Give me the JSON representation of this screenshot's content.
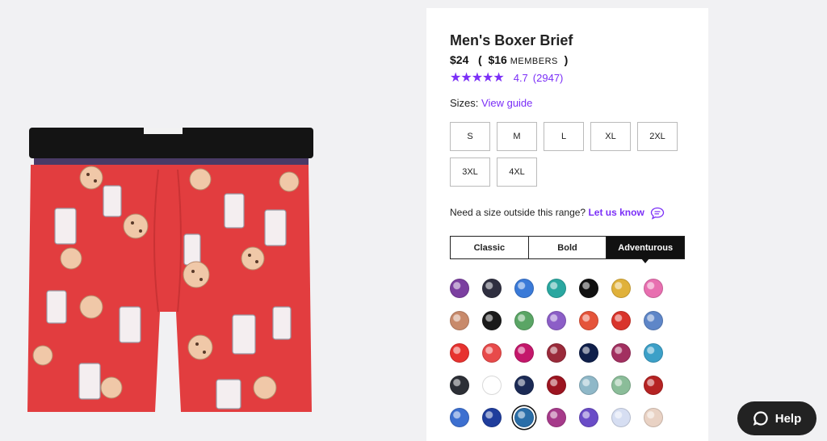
{
  "product": {
    "title": "Men's Boxer Brief",
    "price": "$24",
    "paren_open": "(",
    "member_price": "$16",
    "members_label": "MEMBERS",
    "paren_close": ")",
    "stars": "★★★★★",
    "rating": "4.7",
    "review_count": "(2947)"
  },
  "sizes": {
    "label": "Sizes:",
    "guide_link": "View guide",
    "options": [
      "S",
      "M",
      "L",
      "XL",
      "2XL",
      "3XL",
      "4XL"
    ]
  },
  "size_help": {
    "text": "Need a size outside this range?",
    "link": "Let us know",
    "icon": "chat-bubble-icon"
  },
  "style_tabs": {
    "tabs": [
      "Classic",
      "Bold",
      "Adventurous"
    ],
    "active": "Adventurous"
  },
  "swatch_colors": [
    [
      "#7b3fa0",
      "#2f2f40",
      "#3a7ad8",
      "#2aa7a0",
      "#111111",
      "#e0b13a",
      "#e86fb0"
    ],
    [
      "#c88a6b",
      "#1a1a1a",
      "#5aa565",
      "#8c5ec7",
      "#e5543a",
      "#d9342b",
      "#5e86c8"
    ],
    [
      "#e7322f",
      "#e84a4a",
      "#c4176b",
      "#9a2a3a",
      "#0f1f4a",
      "#a23060",
      "#3ca0c8"
    ],
    [
      "#2c2f36",
      "#ffffff",
      "#1b2a55",
      "#9c1420",
      "#8fb8c8",
      "#8bbd99",
      "#b52323"
    ],
    [
      "#3c6fd0",
      "#1f3d9c",
      "#2a6ea8",
      "#a63a8a",
      "#6a4cc7",
      "#d6def2",
      "#e9d2c4"
    ]
  ],
  "selected_swatch": "4-2",
  "help": {
    "label": "Help",
    "icon": "chat-icon"
  },
  "colors": {
    "accent": "#7b2ff7",
    "dark": "#111111",
    "boxer_red": "#e23d3f",
    "waistband": "#141414"
  }
}
